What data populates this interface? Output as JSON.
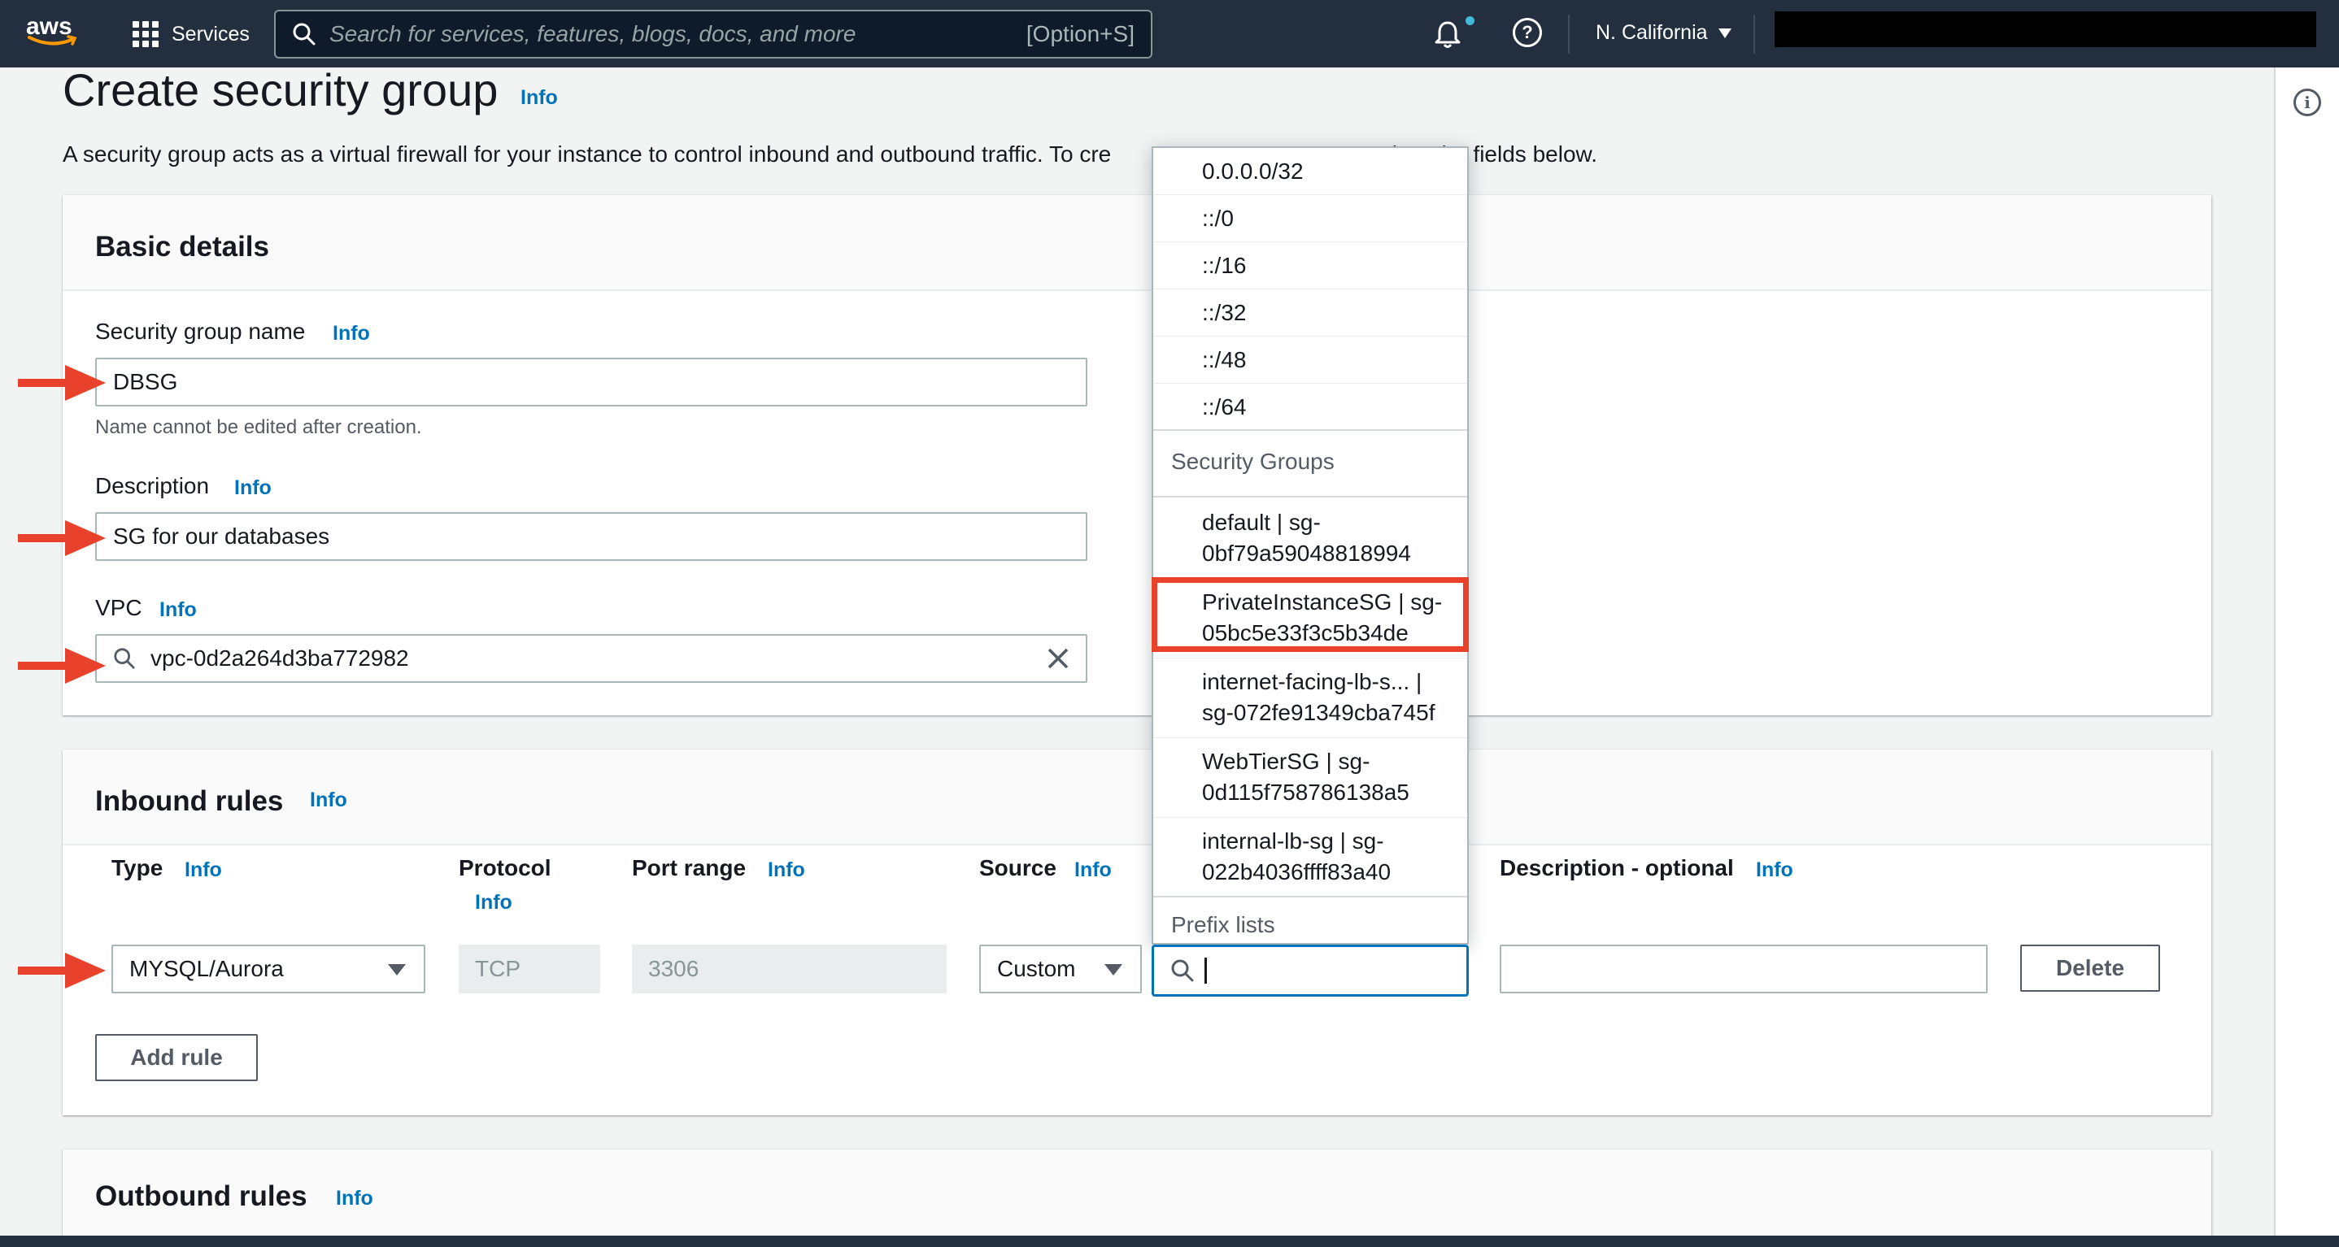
{
  "topnav": {
    "logo": "aws",
    "services": "Services",
    "search_placeholder": "Search for services, features, blogs, docs, and more",
    "search_shortcut": "[Option+S]",
    "region": "N. California"
  },
  "page": {
    "title": "Create security group",
    "info": "Info",
    "description": "A security group acts as a virtual firewall for your instance to control inbound and outbound traffic. To cre",
    "description_tail": "plete the fields below."
  },
  "basic": {
    "header": "Basic details",
    "name_label": "Security group name",
    "name_value": "DBSG",
    "name_hint": "Name cannot be edited after creation.",
    "desc_label": "Description",
    "desc_value": "SG for our databases",
    "vpc_label": "VPC",
    "vpc_value": "vpc-0d2a264d3ba772982",
    "info": "Info"
  },
  "inbound": {
    "header": "Inbound rules",
    "info": "Info",
    "columns": {
      "type": "Type",
      "protocol": "Protocol",
      "port_range": "Port range",
      "source": "Source",
      "description": "Description - optional"
    },
    "row": {
      "type": "MYSQL/Aurora",
      "protocol": "TCP",
      "port_range": "3306",
      "source": "Custom",
      "delete": "Delete"
    },
    "add_rule": "Add rule"
  },
  "outbound": {
    "header": "Outbound rules",
    "info": "Info"
  },
  "dropdown": {
    "cidrs": [
      "0.0.0.0/32",
      "::/0",
      "::/16",
      "::/32",
      "::/48",
      "::/64"
    ],
    "sg_group_label": "Security Groups",
    "security_groups": [
      {
        "line1": "default | sg-",
        "line2": "0bf79a59048818994"
      },
      {
        "line1": "PrivateInstanceSG | sg-",
        "line2": "05bc5e33f3c5b34de"
      },
      {
        "line1": "internet-facing-lb-s... |",
        "line2": "sg-072fe91349cba745f"
      },
      {
        "line1": "WebTierSG | sg-",
        "line2": "0d115f758786138a5"
      },
      {
        "line1": "internal-lb-sg | sg-",
        "line2": "022b4036ffff83a40"
      }
    ],
    "prefix_label": "Prefix lists"
  },
  "colors": {
    "nav_bg": "#232f3e",
    "link": "#0073bb",
    "annotation_red": "#e8412c"
  }
}
